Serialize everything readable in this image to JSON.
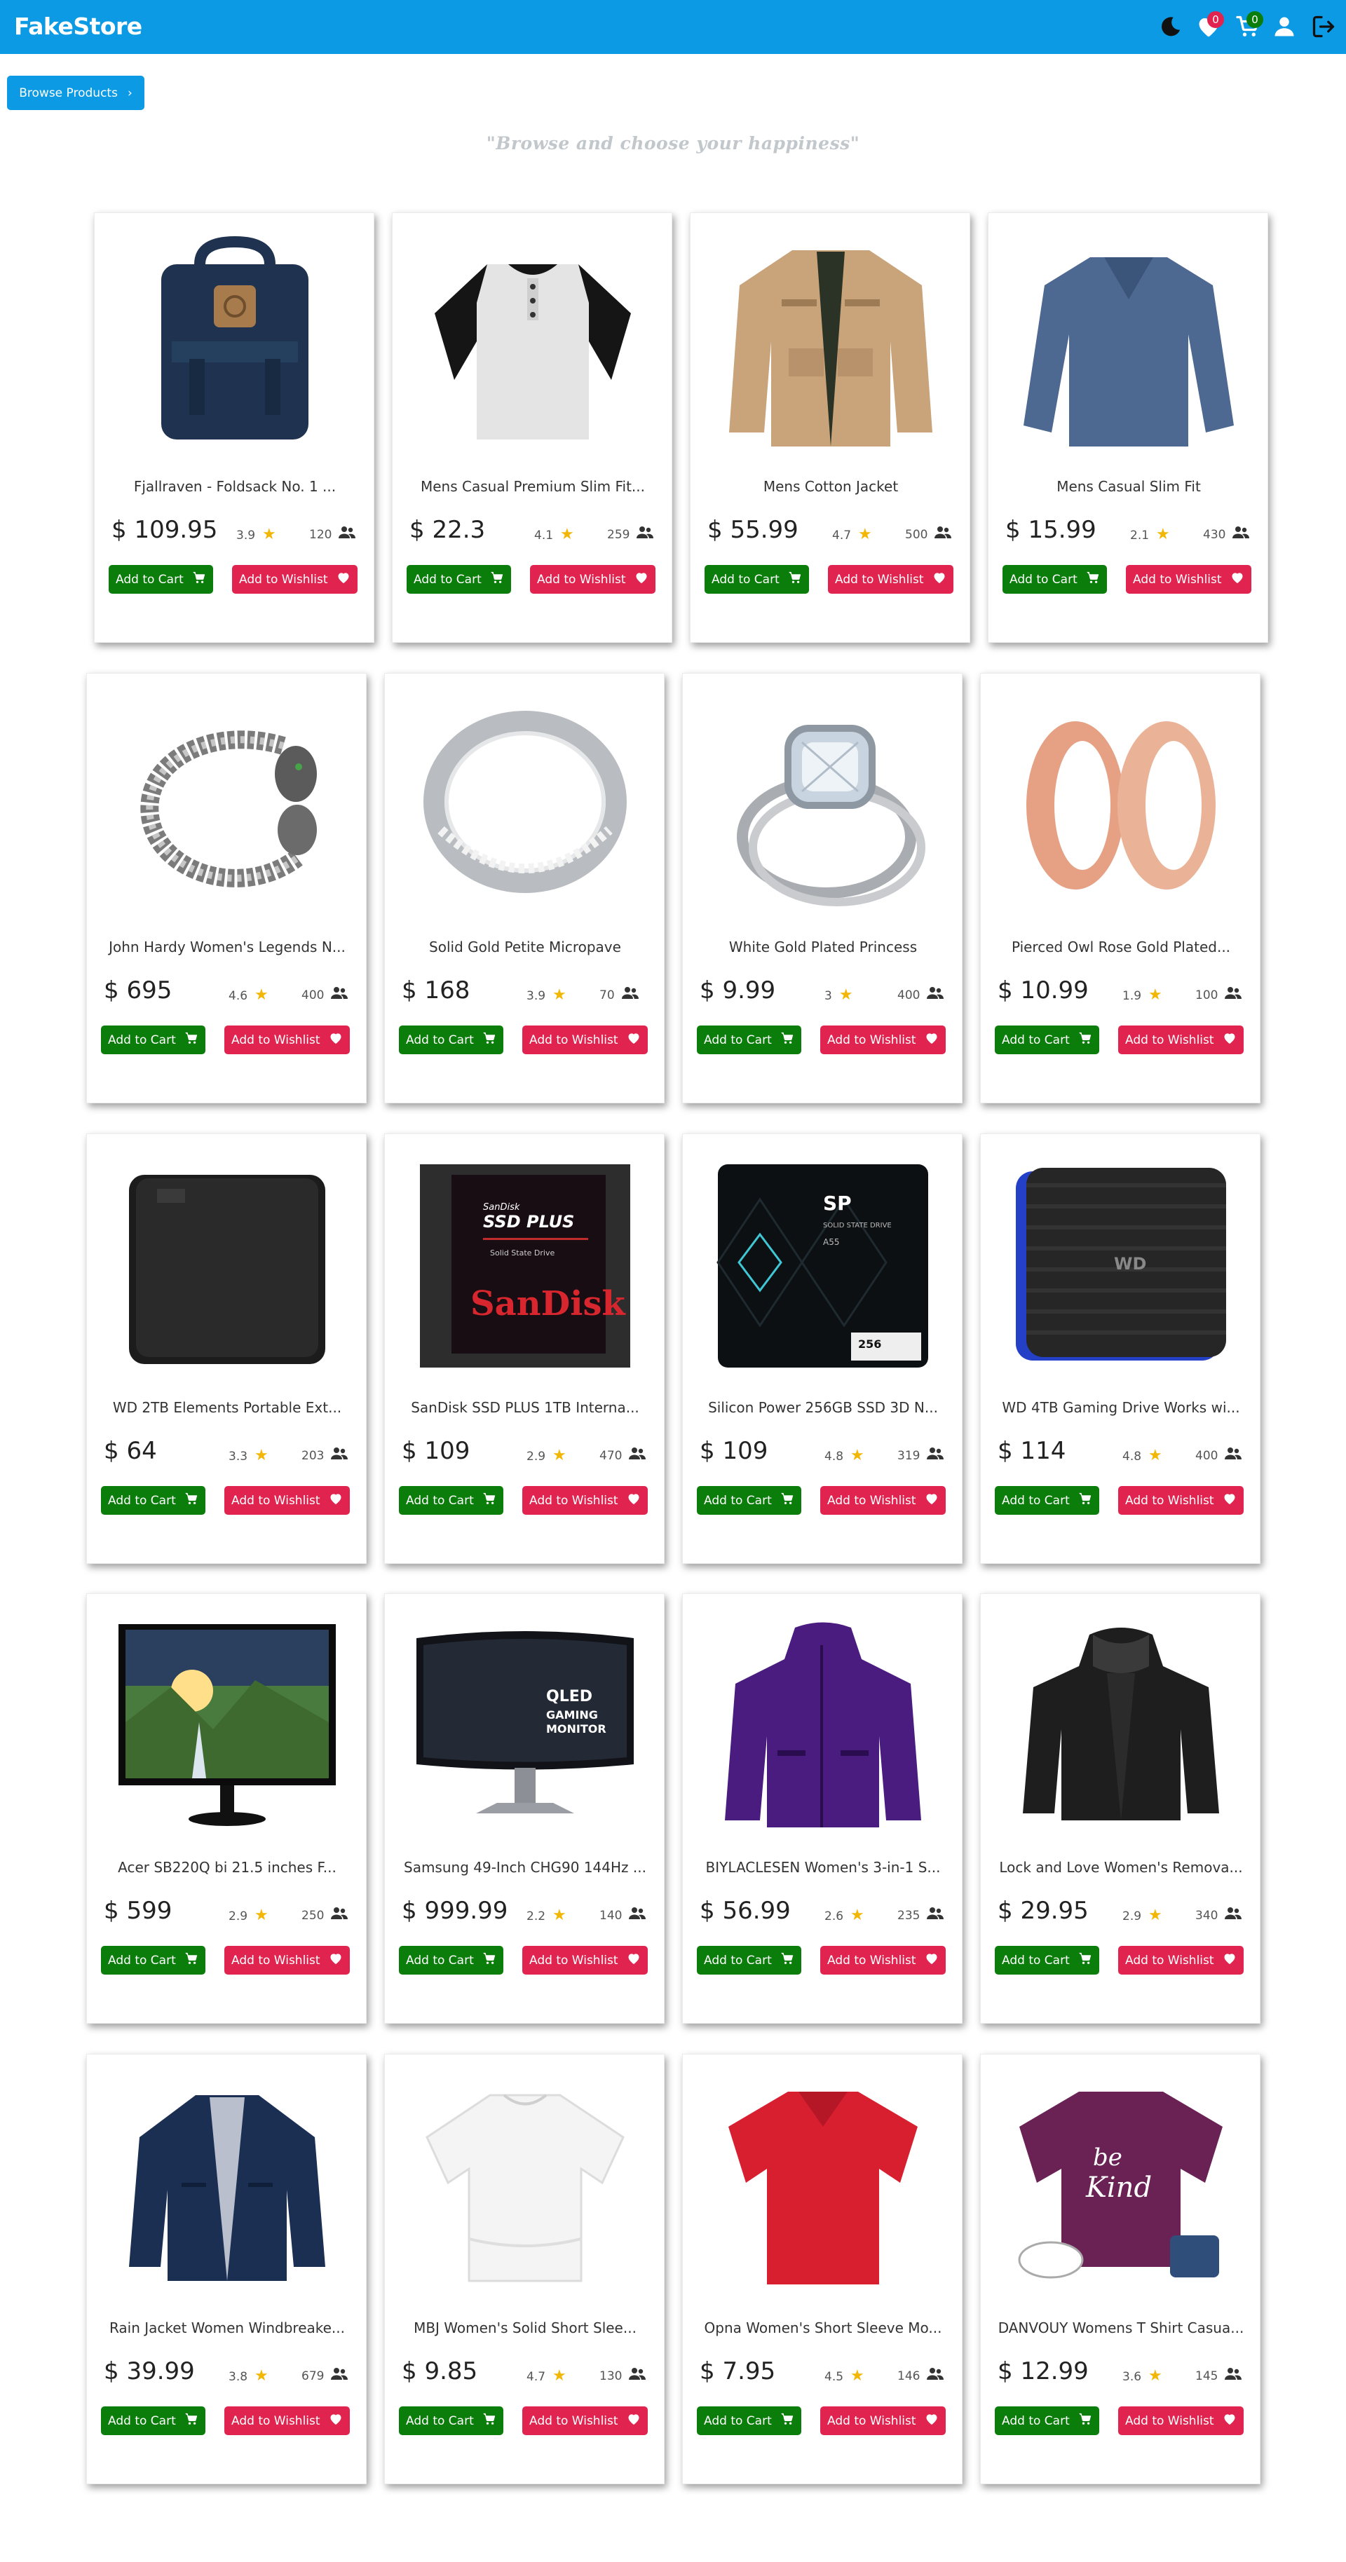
{
  "app": {
    "brand": "FakeStore"
  },
  "nav": {
    "wishlist_count": "0",
    "cart_count": "0"
  },
  "browse_button": {
    "label": "Browse Products"
  },
  "tagline": "\"Browse and choose your happiness\"",
  "buttons": {
    "add_to_cart": "Add to Cart",
    "add_to_wishlist": "Add to Wishlist"
  },
  "colors": {
    "navbar": "#0b9ae3",
    "cart_button": "#0a7d0a",
    "wishlist_button": "#e1244f",
    "star": "#f2b705"
  },
  "products": [
    {
      "title": "Fjallraven - Foldsack No. 1 ...",
      "price": "$ 109.95",
      "rating": "3.9",
      "count": "120",
      "image": "backpack"
    },
    {
      "title": "Mens Casual Premium Slim Fit...",
      "price": "$ 22.3",
      "rating": "4.1",
      "count": "259",
      "image": "raglan-tshirt"
    },
    {
      "title": "Mens Cotton Jacket",
      "price": "$ 55.99",
      "rating": "4.7",
      "count": "500",
      "image": "cotton-jacket"
    },
    {
      "title": "Mens Casual Slim Fit",
      "price": "$ 15.99",
      "rating": "2.1",
      "count": "430",
      "image": "longsleeve-shirt"
    },
    {
      "title": "John Hardy Women's Legends N...",
      "price": "$ 695",
      "rating": "4.6",
      "count": "400",
      "image": "dragon-bracelet"
    },
    {
      "title": "Solid Gold Petite Micropave",
      "price": "$ 168",
      "rating": "3.9",
      "count": "70",
      "image": "ring"
    },
    {
      "title": "White Gold Plated Princess",
      "price": "$ 9.99",
      "rating": "3",
      "count": "400",
      "image": "diamond-ring"
    },
    {
      "title": "Pierced Owl Rose Gold Plated...",
      "price": "$ 10.99",
      "rating": "1.9",
      "count": "100",
      "image": "rose-gold-tunnels"
    },
    {
      "title": "WD 2TB Elements Portable Ext...",
      "price": "$ 64",
      "rating": "3.3",
      "count": "203",
      "image": "hard-drive-black"
    },
    {
      "title": "SanDisk SSD PLUS 1TB Interna...",
      "price": "$ 109",
      "rating": "2.9",
      "count": "470",
      "image": "sandisk-ssd"
    },
    {
      "title": "Silicon Power 256GB SSD 3D N...",
      "price": "$ 109",
      "rating": "4.8",
      "count": "319",
      "image": "silicon-power-ssd"
    },
    {
      "title": "WD 4TB Gaming Drive Works wi...",
      "price": "$ 114",
      "rating": "4.8",
      "count": "400",
      "image": "gaming-drive"
    },
    {
      "title": "Acer SB220Q bi 21.5 inches F...",
      "price": "$ 599",
      "rating": "2.9",
      "count": "250",
      "image": "monitor"
    },
    {
      "title": "Samsung 49-Inch CHG90 144Hz ...",
      "price": "$ 999.99",
      "rating": "2.2",
      "count": "140",
      "image": "curved-monitor"
    },
    {
      "title": "BIYLACLESEN Women's 3-in-1 S...",
      "price": "$ 56.99",
      "rating": "2.6",
      "count": "235",
      "image": "purple-jacket"
    },
    {
      "title": "Lock and Love Women's Remova...",
      "price": "$ 29.95",
      "rating": "2.9",
      "count": "340",
      "image": "leather-jacket"
    },
    {
      "title": "Rain Jacket Women Windbreake...",
      "price": "$ 39.99",
      "rating": "3.8",
      "count": "679",
      "image": "rain-jacket"
    },
    {
      "title": "MBJ Women's Solid Short Slee...",
      "price": "$ 9.85",
      "rating": "4.7",
      "count": "130",
      "image": "white-top"
    },
    {
      "title": "Opna Women's Short Sleeve Mo...",
      "price": "$ 7.95",
      "rating": "4.5",
      "count": "146",
      "image": "red-tshirt"
    },
    {
      "title": "DANVOUY Womens T Shirt Casua...",
      "price": "$ 12.99",
      "rating": "3.6",
      "count": "145",
      "image": "be-kind-tshirt"
    }
  ]
}
